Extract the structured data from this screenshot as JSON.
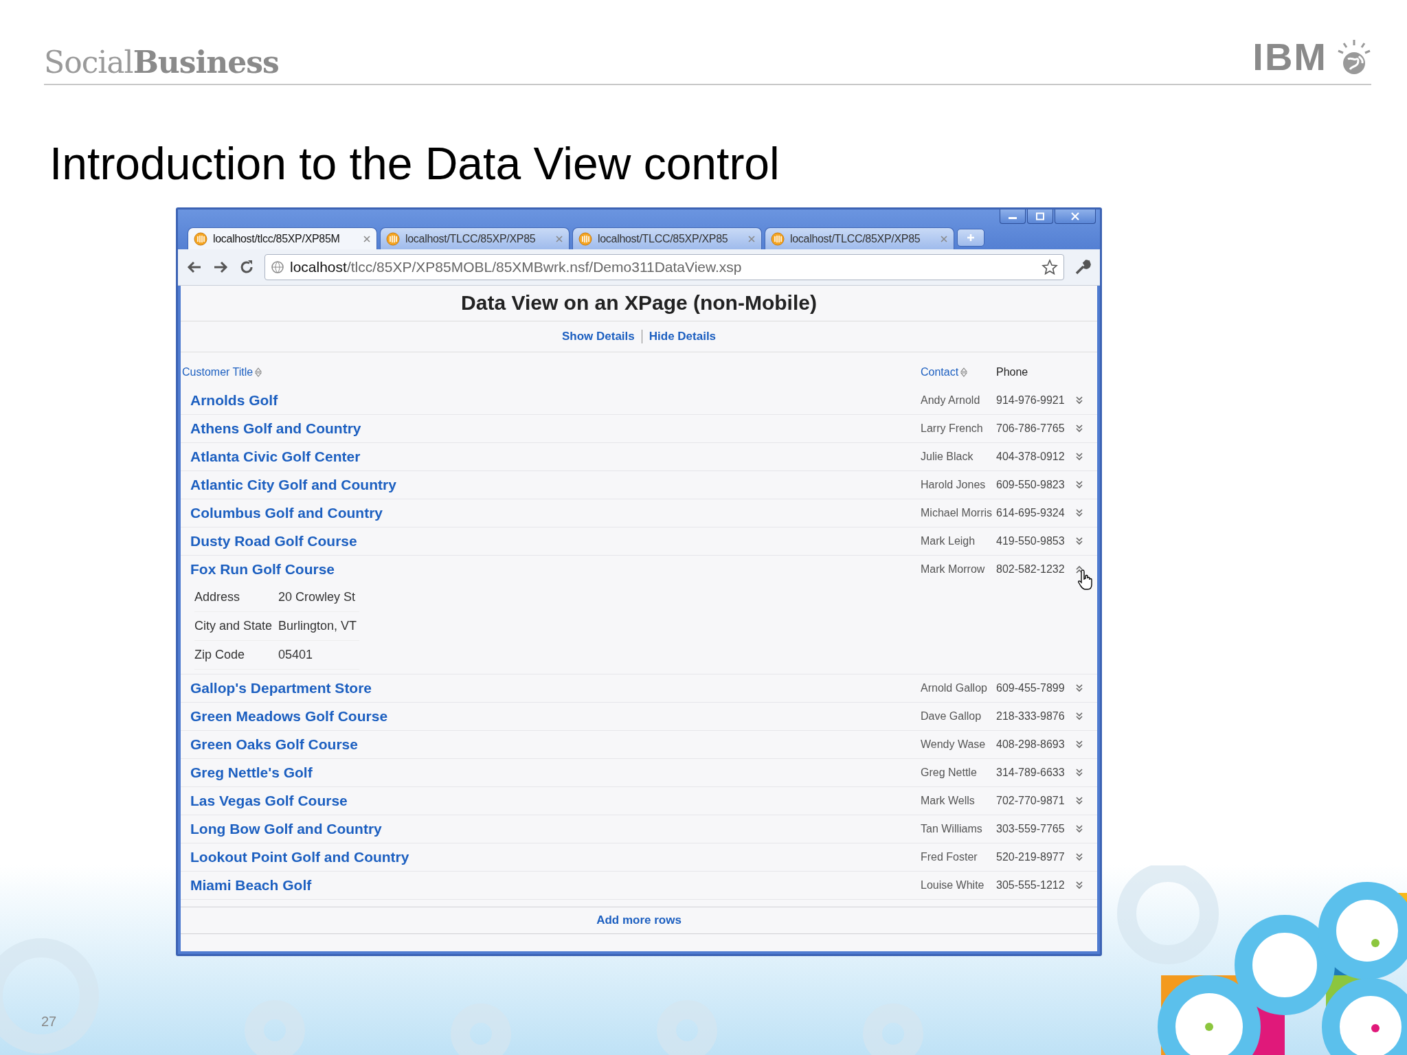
{
  "slide": {
    "brand": "Social**Business**",
    "logo": "IBM",
    "title": "Introduction to the Data View control",
    "page_number": "27"
  },
  "browser": {
    "tabs": [
      {
        "label": "localhost/tlcc/85XP/XP85M",
        "selected": true
      },
      {
        "label": "localhost/TLCC/85XP/XP85",
        "selected": false
      },
      {
        "label": "localhost/TLCC/85XP/XP85",
        "selected": false
      },
      {
        "label": "localhost/TLCC/85XP/XP85",
        "selected": false
      }
    ],
    "url_host": "localhost",
    "url_path": "/tlcc/85XP/XP85MOBL/85XMBwrk.nsf/Demo311DataView.xsp"
  },
  "page": {
    "heading": "Data View on an XPage (non-Mobile)",
    "actions": [
      "Show Details",
      "Hide Details"
    ],
    "columns": [
      {
        "label": "Customer Title",
        "sortable": true
      },
      {
        "label": "Contact",
        "sortable": true
      },
      {
        "label": "Phone",
        "sortable": false
      }
    ],
    "rows": [
      {
        "title": "Arnolds Golf",
        "contact": "Andy Arnold",
        "phone": "914-976-9921",
        "expanded": false
      },
      {
        "title": "Athens Golf and Country",
        "contact": "Larry French",
        "phone": "706-786-7765",
        "expanded": false
      },
      {
        "title": "Atlanta Civic Golf Center",
        "contact": "Julie Black",
        "phone": "404-378-0912",
        "expanded": false
      },
      {
        "title": "Atlantic City Golf and Country",
        "contact": "Harold Jones",
        "phone": "609-550-9823",
        "expanded": false
      },
      {
        "title": "Columbus Golf and Country",
        "contact": "Michael Morris",
        "phone": "614-695-9324",
        "expanded": false
      },
      {
        "title": "Dusty Road Golf Course",
        "contact": "Mark Leigh",
        "phone": "419-550-9853",
        "expanded": false
      },
      {
        "title": "Fox Run Golf Course",
        "contact": "Mark Morrow",
        "phone": "802-582-1232",
        "expanded": true,
        "details": [
          {
            "label": "Address",
            "value": "20 Crowley St"
          },
          {
            "label": "City and State",
            "value": "Burlington, VT"
          },
          {
            "label": "Zip Code",
            "value": "05401"
          }
        ]
      },
      {
        "title": "Gallop's Department Store",
        "contact": "Arnold Gallop",
        "phone": "609-455-7899",
        "expanded": false
      },
      {
        "title": "Green Meadows Golf Course",
        "contact": "Dave Gallop",
        "phone": "218-333-9876",
        "expanded": false
      },
      {
        "title": "Green Oaks Golf Course",
        "contact": "Wendy Wase",
        "phone": "408-298-8693",
        "expanded": false
      },
      {
        "title": "Greg Nettle's Golf",
        "contact": "Greg Nettle",
        "phone": "314-789-6633",
        "expanded": false
      },
      {
        "title": "Las Vegas Golf Course",
        "contact": "Mark Wells",
        "phone": "702-770-9871",
        "expanded": false
      },
      {
        "title": "Long Bow Golf and Country",
        "contact": "Tan Williams",
        "phone": "303-559-7765",
        "expanded": false
      },
      {
        "title": "Lookout Point Golf and Country",
        "contact": "Fred Foster",
        "phone": "520-219-8977",
        "expanded": false
      },
      {
        "title": "Miami Beach Golf",
        "contact": "Louise White",
        "phone": "305-555-1212",
        "expanded": false
      }
    ],
    "footer": "Add more rows"
  }
}
